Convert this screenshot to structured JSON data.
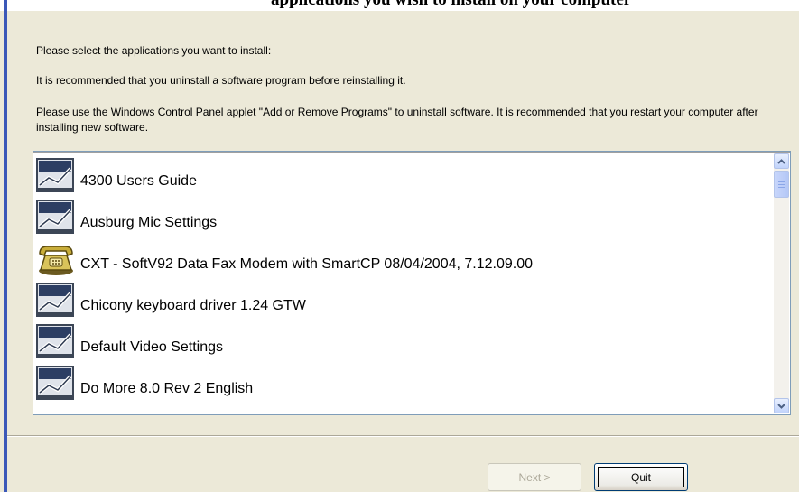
{
  "header": {
    "title_fragment": "applications you wish to install on your computer"
  },
  "messages": {
    "select": "Please select the applications you want to install:",
    "recommend_uninstall": "It is recommended that you uninstall a software program before reinstalling it.",
    "control_panel": "Please use the Windows Control Panel applet \"Add or Remove Programs\" to uninstall software.  It is recommended that you restart your computer after installing new software."
  },
  "applications": [
    {
      "label": "4300 Users Guide",
      "icon": "installer-icon"
    },
    {
      "label": "Ausburg Mic Settings",
      "icon": "installer-icon"
    },
    {
      "label": "CXT - SoftV92 Data Fax Modem with SmartCP  08/04/2004, 7.12.09.00",
      "icon": "modem-phone-icon"
    },
    {
      "label": "Chicony keyboard driver 1.24 GTW",
      "icon": "installer-icon"
    },
    {
      "label": "Default Video Settings",
      "icon": "installer-icon"
    },
    {
      "label": "Do More 8.0 Rev 2 English",
      "icon": "installer-icon"
    }
  ],
  "buttons": {
    "next": "Next >",
    "quit": "Quit"
  },
  "colors": {
    "dialog_background": "#ece9d8",
    "list_border": "#7f9db9",
    "accent_blue": "#3b58b8"
  }
}
